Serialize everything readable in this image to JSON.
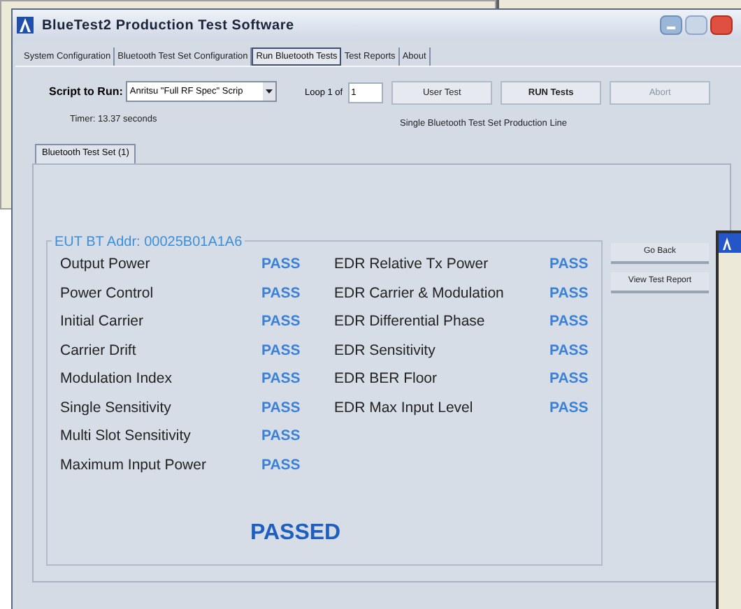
{
  "window": {
    "title": "BlueTest2 Production Test Software",
    "controls": [
      {
        "kind": "minimize"
      },
      {
        "kind": "maximize"
      },
      {
        "kind": "close"
      }
    ]
  },
  "tabs": [
    {
      "label": "System Configuration",
      "selected": false
    },
    {
      "label": "Bluetooth Test Set Configuration",
      "selected": false
    },
    {
      "label": "Run Bluetooth Tests",
      "selected": true
    },
    {
      "label": "Test Reports",
      "selected": false
    },
    {
      "label": "About",
      "selected": false
    }
  ],
  "script": {
    "label": "Script to Run:",
    "value": "Anritsu \"Full RF Spec\" Scrip"
  },
  "timer": "Timer: 13.37 seconds",
  "loop": {
    "label": "Loop 1 of",
    "value": "1"
  },
  "buttons": [
    {
      "label": "User Test",
      "kind": "normal",
      "disabled": false
    },
    {
      "label": "RUN Tests",
      "kind": "primary",
      "disabled": false
    },
    {
      "label": "Abort",
      "kind": "normal",
      "disabled": true
    }
  ],
  "mode": "Single Bluetooth Test Set Production Line",
  "subtabs": [
    {
      "label": "Bluetooth Test Set (1)",
      "selected": true
    }
  ],
  "group": {
    "title": "EUT BT Addr: 00025B01A1A6",
    "left_results": [
      {
        "test": "Output Power",
        "result": "PASS"
      },
      {
        "test": "Power Control",
        "result": "PASS"
      },
      {
        "test": "Initial Carrier",
        "result": "PASS"
      },
      {
        "test": "Carrier Drift",
        "result": "PASS"
      },
      {
        "test": "Modulation Index",
        "result": "PASS"
      },
      {
        "test": "Single Sensitivity",
        "result": "PASS"
      },
      {
        "test": "Multi Slot Sensitivity",
        "result": "PASS"
      },
      {
        "test": "Maximum Input Power",
        "result": "PASS"
      }
    ],
    "right_results": [
      {
        "test": "EDR Relative Tx Power",
        "result": "PASS"
      },
      {
        "test": "EDR Carrier & Modulation",
        "result": "PASS"
      },
      {
        "test": "EDR Differential Phase",
        "result": "PASS"
      },
      {
        "test": "EDR Sensitivity",
        "result": "PASS"
      },
      {
        "test": "EDR BER Floor",
        "result": "PASS"
      },
      {
        "test": "EDR Max Input Level",
        "result": "PASS"
      }
    ],
    "overall": "PASSED"
  },
  "side_buttons": [
    "Go Back",
    "View Test Report"
  ]
}
